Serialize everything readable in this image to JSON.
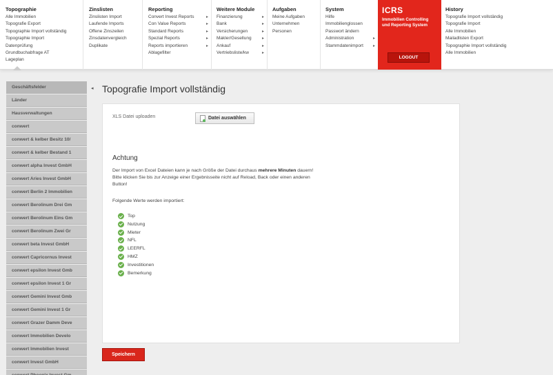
{
  "nav": {
    "topographie": {
      "header": "Topographie",
      "items": [
        "Alle Immobilien",
        "Topografie Export",
        "Topographie Import vollständig",
        "Topographie Import",
        "Datenprüfung",
        "Grundbuchabfrage AT",
        "Lageplan"
      ]
    },
    "zinslisten": {
      "header": "Zinslisten",
      "items": [
        "Zinslisten Import",
        "Laufende Imports",
        "Offene Zinszeilen",
        "Zinsdatenvergleich",
        "Duplikate"
      ]
    },
    "reporting": {
      "header": "Reporting",
      "items": [
        "Convert Invest Reports",
        "Con Value Reports",
        "Standard Reports",
        "Spezial Reports",
        "Reports importieren",
        "Ablagefilter"
      ]
    },
    "weitere": {
      "header": "Weitere Module",
      "items": [
        "Finanzierung",
        "Bank",
        "Versicherungen",
        "Makler/Gesellung",
        "Ankauf",
        "Vertriebsliste/kw"
      ]
    },
    "aufgaben": {
      "header": "Aufgaben",
      "items": [
        "Meine Aufgaben",
        "Unternehmen",
        "Personen"
      ]
    },
    "system": {
      "header": "System",
      "items": [
        "Hilfe",
        "Immobilienglossen",
        "Passwort ändern",
        "Administration",
        "Stammdatenimport"
      ]
    },
    "history": {
      "header": "History",
      "items": [
        "Topografie Import vollständig",
        "Topografie Import",
        "Alle Immobilien",
        "Mailadlisten Export",
        "Topographie Import vollständig",
        "Alle Immobilien"
      ]
    }
  },
  "brand": {
    "logo": "ICRS",
    "subtitle_line1": "Immobilien Controlling",
    "subtitle_line2": "und Reporting System",
    "logout_label": "LOGOUT",
    "accent": "#e2261c"
  },
  "sidebar": {
    "pin_glyph": "◂",
    "items": [
      "Geschäftsfelder",
      "Länder",
      "Hausverwaltungen",
      "conwert",
      "conwert & kelber Besitz 10/",
      "conwert & kelber Bestand 1",
      "conwert alpha Invest GmbH",
      "conwert Aries Invest GmbH",
      "conwert Berlin 2 Immobilien",
      "conwert Berolinum Drei Gm",
      "conwert Berolinum Eins Gm",
      "conwert Berolinum Zwei Gr",
      "conwert beta Invest GmbH",
      "conwert Capricornus Invest",
      "conwert epsilon Invest Gmb",
      "conwert epsilon Invest 1 Gr",
      "conwert Gemini Invest Gmb",
      "conwert Gemini Invest 1 Gr",
      "conwert Grazer Damm Deve",
      "conwert Immobilien Develo",
      "conwert Immobilien Invest",
      "conwert Invest GmbH",
      "conwert Phoenix Invest Gm"
    ]
  },
  "main": {
    "page_title": "Topografie Import vollständig",
    "xls_label": "XLS Datei uploaden",
    "file_button": "Datei auswählen",
    "warning_title": "Achtung",
    "para_part1": "Der Import von Excel Dateien kann je nach Größe der Datei durchaus ",
    "para_bold": "mehrere Minuten",
    "para_part2": " dauern! Bitte klicken Sie bis zur Anzeige einer Ergebnisseite nicht auf Reload, Back oder einen anderen Button!",
    "fields_intro": "Folgende Werte werden importiert:",
    "fields": [
      "Top",
      "Nutzung",
      "Mieter",
      "NFL",
      "LEERFL",
      "HMZ",
      "Investitionen",
      "Bemerkung"
    ],
    "save_label": "Speichern"
  }
}
